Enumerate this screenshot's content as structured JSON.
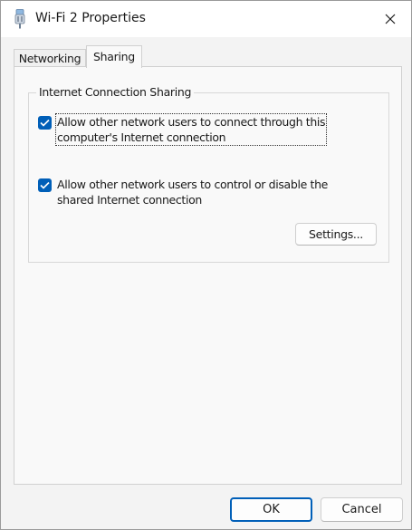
{
  "window": {
    "title": "Wi-Fi 2 Properties"
  },
  "tabs": [
    {
      "label": "Networking",
      "selected": false
    },
    {
      "label": "Sharing",
      "selected": true
    }
  ],
  "sharing": {
    "group_title": "Internet Connection Sharing",
    "options": [
      {
        "lines": [
          "Allow other network users to connect through this",
          "computer's Internet connection"
        ],
        "checked": true
      },
      {
        "lines": [
          "Allow other network users to control or disable the",
          "shared Internet connection"
        ],
        "checked": true
      }
    ],
    "settings_label": "Settings..."
  },
  "footer": {
    "ok_label": "OK",
    "cancel_label": "Cancel"
  },
  "colors": {
    "accent": "#005fb8",
    "panel": "#f9f9f9",
    "window": "#f3f3f3"
  },
  "icons": {
    "title": "network-adapter-icon",
    "close": "close-icon",
    "check": "checkmark-icon"
  }
}
